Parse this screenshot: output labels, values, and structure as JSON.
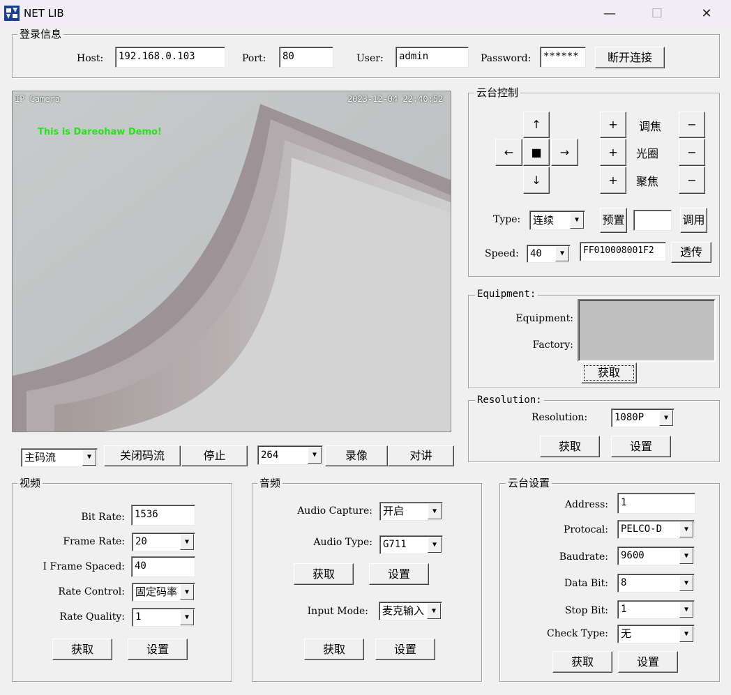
{
  "window": {
    "title": "NET LIB",
    "minimize": "—",
    "maximize": "☐",
    "close": "✕"
  },
  "login": {
    "legend": "登录信息",
    "host_label": "Host:",
    "host_value": "192.168.0.103",
    "port_label": "Port:",
    "port_value": "80",
    "user_label": "User:",
    "user_value": "admin",
    "password_label": "Password:",
    "password_value": "******",
    "disconnect_button": "断开连接"
  },
  "video": {
    "osd_name": "IP Camera",
    "osd_time": "2023-12-04 22:40:52",
    "demo_text": "This is Dareohaw Demo!"
  },
  "stream_bar": {
    "stream_select": "主码流",
    "close_stream": "关闭码流",
    "stop": "停止",
    "codec_select": "264",
    "record": "录像",
    "talk": "对讲"
  },
  "ptz": {
    "legend": "云台控制",
    "up": "↑",
    "left": "←",
    "stop": "■",
    "right": "→",
    "down": "↓",
    "zoom_label": "调焦",
    "iris_label": "光圈",
    "focus_label": "聚焦",
    "plus": "+",
    "minus": "−",
    "type_label": "Type:",
    "type_value": "连续",
    "preset_button": "预置",
    "preset_value": "",
    "call_button": "调用",
    "speed_label": "Speed:",
    "speed_value": "40",
    "command_value": "FF010008001F2",
    "transparent_button": "透传"
  },
  "equipment": {
    "legend": "Equipment:",
    "equipment_label": "Equipment:",
    "factory_label": "Factory:",
    "get_button": "获取"
  },
  "resolution": {
    "legend": "Resolution:",
    "resolution_label": "Resolution:",
    "resolution_value": "1080P",
    "get_button": "获取",
    "set_button": "设置"
  },
  "video_settings": {
    "legend": "视频",
    "bitrate_label": "Bit Rate:",
    "bitrate_value": "1536",
    "framerate_label": "Frame Rate:",
    "framerate_value": "20",
    "iframe_label": "I Frame Spaced:",
    "iframe_value": "40",
    "ratecontrol_label": "Rate Control:",
    "ratecontrol_value": "固定码率",
    "ratequality_label": "Rate Quality:",
    "ratequality_value": "1",
    "get_button": "获取",
    "set_button": "设置"
  },
  "audio_settings": {
    "legend": "音频",
    "capture_label": "Audio Capture:",
    "capture_value": "开启",
    "type_label": "Audio Type:",
    "type_value": "G711",
    "get_button_1": "获取",
    "set_button_1": "设置",
    "input_label": "Input Mode:",
    "input_value": "麦克输入",
    "get_button_2": "获取",
    "set_button_2": "设置"
  },
  "ptz_settings": {
    "legend": "云台设置",
    "address_label": "Address:",
    "address_value": "1",
    "protocol_label": "Protocal:",
    "protocol_value": "PELCO-D",
    "baudrate_label": "Baudrate:",
    "baudrate_value": "9600",
    "databit_label": "Data Bit:",
    "databit_value": "8",
    "stopbit_label": "Stop Bit:",
    "stopbit_value": "1",
    "checktype_label": "Check Type:",
    "checktype_value": "无",
    "get_button": "获取",
    "set_button": "设置"
  }
}
